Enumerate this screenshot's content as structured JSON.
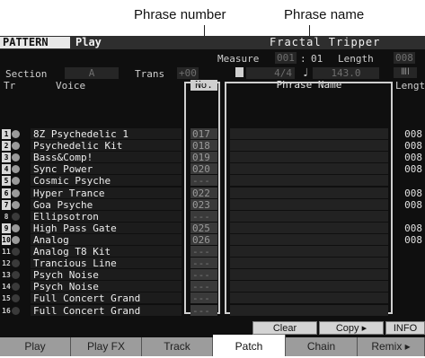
{
  "callouts": {
    "phrase_number": "Phrase number",
    "phrase_name": "Phrase name"
  },
  "header": {
    "pattern_label": "PATTERN",
    "mode": "Play",
    "song_name": "Fractal Tripper"
  },
  "measure": {
    "label": "Measure",
    "current": "001",
    "sep": ":",
    "beat": "01",
    "length_label": "Length",
    "length": "008"
  },
  "section": {
    "label": "Section",
    "value": "A",
    "trans_label": "Trans",
    "trans_value": "+00"
  },
  "meter": {
    "time_signature": "4/4",
    "tempo_icon": "quarter-note",
    "tempo": "143.0",
    "meter_icon": "meter-icon"
  },
  "table": {
    "headers": {
      "tr": "Tr",
      "voice": "Voice",
      "no": "No.",
      "phrase_name": "Phrase Name",
      "length": "Length"
    },
    "rows": [
      {
        "tr": "1",
        "voice": "8Z Psychedelic 1",
        "no": "017",
        "name": "",
        "length": "008",
        "active": true
      },
      {
        "tr": "2",
        "voice": "Psychedelic Kit",
        "no": "018",
        "name": "",
        "length": "008",
        "active": true
      },
      {
        "tr": "3",
        "voice": "Bass&Comp!",
        "no": "019",
        "name": "",
        "length": "008",
        "active": true
      },
      {
        "tr": "4",
        "voice": "Sync Power",
        "no": "020",
        "name": "",
        "length": "008",
        "active": true
      },
      {
        "tr": "5",
        "voice": "Cosmic Psyche",
        "no": "---",
        "name": "",
        "length": "",
        "active": true
      },
      {
        "tr": "6",
        "voice": "Hyper Trance",
        "no": "022",
        "name": "",
        "length": "008",
        "active": true
      },
      {
        "tr": "7",
        "voice": "Goa Psyche",
        "no": "023",
        "name": "",
        "length": "008",
        "active": true
      },
      {
        "tr": "8",
        "voice": "Ellipsotron",
        "no": "---",
        "name": "",
        "length": "",
        "active": false
      },
      {
        "tr": "9",
        "voice": "High Pass Gate",
        "no": "025",
        "name": "",
        "length": "008",
        "active": true
      },
      {
        "tr": "10",
        "voice": "Analog",
        "no": "026",
        "name": "",
        "length": "008",
        "active": true
      },
      {
        "tr": "11",
        "voice": "Analog T8 Kit",
        "no": "---",
        "name": "",
        "length": "",
        "active": false
      },
      {
        "tr": "12",
        "voice": "Trancious Line",
        "no": "---",
        "name": "",
        "length": "",
        "active": false
      },
      {
        "tr": "13",
        "voice": "Psych Noise",
        "no": "---",
        "name": "",
        "length": "",
        "active": false
      },
      {
        "tr": "14",
        "voice": "Psych Noise",
        "no": "---",
        "name": "",
        "length": "",
        "active": false
      },
      {
        "tr": "15",
        "voice": "Full Concert Grand",
        "no": "---",
        "name": "",
        "length": "",
        "active": false
      },
      {
        "tr": "16",
        "voice": "Full Concert Grand",
        "no": "---",
        "name": "",
        "length": "",
        "active": false
      }
    ]
  },
  "buttons": {
    "clear": "Clear",
    "copy": "Copy",
    "info": "INFO"
  },
  "tabs": [
    {
      "label": "Play",
      "active": false
    },
    {
      "label": "Play FX",
      "active": false
    },
    {
      "label": "Track",
      "active": false
    },
    {
      "label": "Patch",
      "active": true
    },
    {
      "label": "Chain",
      "active": false
    },
    {
      "label": "Remix",
      "active": false
    }
  ],
  "colors": {
    "screen_bg": "#0f0f0f",
    "active_tab": "#ffffff",
    "tab_bg": "#9c9c9c"
  }
}
